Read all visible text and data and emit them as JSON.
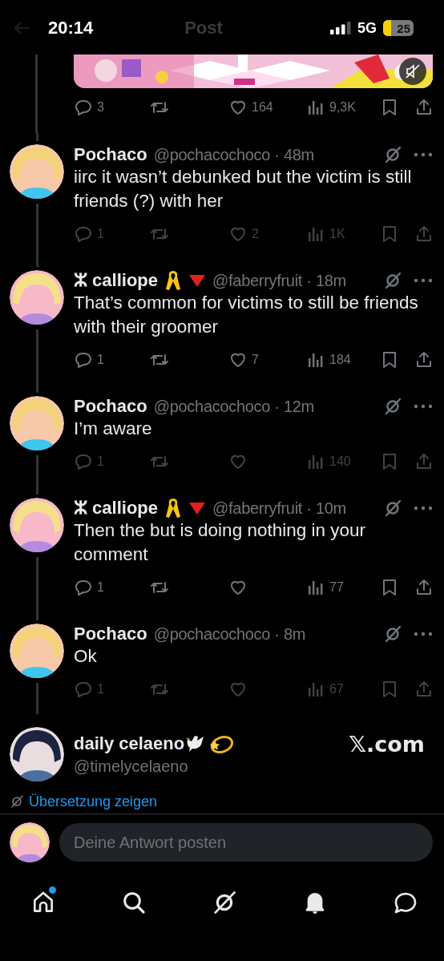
{
  "status_bar": {
    "time": "20:14",
    "network": "5G",
    "battery": "25"
  },
  "header": {
    "title": "Post"
  },
  "media_post": {
    "muted": true,
    "actions": {
      "dimmed": false,
      "replies": "3",
      "likes": "164",
      "views": "9,3K"
    }
  },
  "replies": [
    {
      "name": "Pochaco",
      "meta": "@pochacochoco · 48m",
      "text": "iirc it wasn’t debunked but the victim is still friends (?) with her",
      "avatar": {
        "kind": "sunglasses"
      },
      "actions": {
        "dimmed": true,
        "replies": "1",
        "likes": "2",
        "views": "1K"
      }
    },
    {
      "name": "ⵣ calliope",
      "badges": [
        {
          "kind": "ribbon"
        },
        {
          "kind": "triangle"
        }
      ],
      "meta": "@faberryfruit · 18m",
      "text": "That’s common for victims to still be friends with their groomer",
      "avatar": {
        "kind": "pink"
      },
      "actions": {
        "dimmed": false,
        "replies": "1",
        "likes": "7",
        "views": "184"
      }
    },
    {
      "name": "Pochaco",
      "meta": "@pochacochoco · 12m",
      "text": "I’m aware",
      "avatar": {
        "kind": "sunglasses"
      },
      "actions": {
        "dimmed": true,
        "replies": "1",
        "views": "140"
      }
    },
    {
      "name": "ⵣ calliope",
      "badges": [
        {
          "kind": "ribbon"
        },
        {
          "kind": "triangle"
        }
      ],
      "meta": "@faberryfruit · 10m",
      "text": "Then the but is doing nothing in your comment",
      "avatar": {
        "kind": "pink"
      },
      "actions": {
        "dimmed": false,
        "replies": "1",
        "views": "77"
      }
    },
    {
      "name": "Pochaco",
      "meta": "@pochacochoco · 8m",
      "text": "Ok",
      "avatar": {
        "kind": "sunglasses"
      },
      "actions": {
        "dimmed": true,
        "replies": "1",
        "views": "67"
      }
    }
  ],
  "quoted_card": {
    "name": "daily celaeno",
    "badges": [
      {
        "kind": "dove"
      },
      {
        "kind": "star-ring"
      }
    ],
    "handle": "@timelycelaeno",
    "avatar": {
      "kind": "dark"
    },
    "site": "𝕏.com",
    "translate_link": "Übersetzung zeigen"
  },
  "composer": {
    "placeholder": "Deine Antwort posten",
    "avatar": {
      "kind": "pink"
    }
  },
  "nav": [
    {
      "kind": "home",
      "selected": false,
      "badge": true
    },
    {
      "kind": "search",
      "selected": false,
      "badge": false
    },
    {
      "kind": "grok",
      "selected": false,
      "badge": false
    },
    {
      "kind": "bell",
      "selected": true,
      "badge": false
    },
    {
      "kind": "messages",
      "selected": false,
      "badge": false
    }
  ]
}
